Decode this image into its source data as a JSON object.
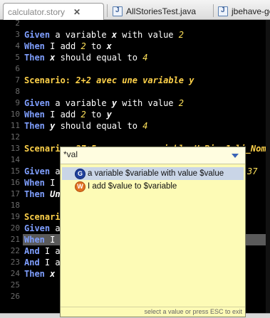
{
  "tabs": [
    {
      "label": "calculator.story",
      "close": "✕",
      "active": true
    },
    {
      "label": "AllStoriesTest.java",
      "active": false
    },
    {
      "label": "jbehave-ge",
      "active": false
    }
  ],
  "gutter": [
    "2",
    "3",
    "4",
    "5",
    "6",
    "7",
    "8",
    "9",
    "10",
    "11",
    "12",
    "13",
    "14",
    "15",
    "16",
    "17",
    "18",
    "19",
    "20",
    "21",
    "22",
    "23",
    "24",
    "25",
    "26"
  ],
  "code": {
    "l3": [
      "Given",
      " a variable ",
      "x",
      " with value ",
      "2"
    ],
    "l4": [
      "When",
      " I add ",
      "2",
      " to ",
      "x"
    ],
    "l5": [
      "Then",
      " ",
      "x",
      " should equal to ",
      "4"
    ],
    "l7": [
      "Scenario:",
      " 2+2 avec une variable y"
    ],
    "l9": [
      "Given",
      " a variable ",
      "y",
      " with value ",
      "2"
    ],
    "l10": [
      "When",
      " I add ",
      "2",
      " to ",
      "y"
    ],
    "l11": [
      "Then",
      " ",
      "y",
      " should equal to ",
      "4"
    ],
    "l13": [
      "Scenario:",
      " 37+5 avec une variable UnBienJoli_Nom"
    ],
    "l15": [
      "Given",
      " a",
      "37"
    ],
    "l16": [
      "When",
      " I "
    ],
    "l17": [
      "Then",
      " ",
      "Un"
    ],
    "l19": [
      "Scenari"
    ],
    "l21": [
      "Given",
      " a"
    ],
    "l22": [
      "When",
      " I "
    ],
    "l23": [
      "And",
      " I ad"
    ],
    "l24": [
      "And",
      " I ad"
    ],
    "l25": [
      "Then",
      " ",
      "x",
      " s"
    ]
  },
  "popup": {
    "filter": "*val",
    "items": [
      {
        "badge": "G",
        "text": "a variable $variable with value $value",
        "selected": true
      },
      {
        "badge": "W",
        "text": "I add $value to $variable",
        "selected": false
      }
    ],
    "footer": "select a value or press ESC to exit"
  },
  "colors": {
    "keyword": "#7f9fff",
    "scenario": "#ffd24a",
    "number": "#ffe25a",
    "popup_bg": "#fdfbb6"
  }
}
